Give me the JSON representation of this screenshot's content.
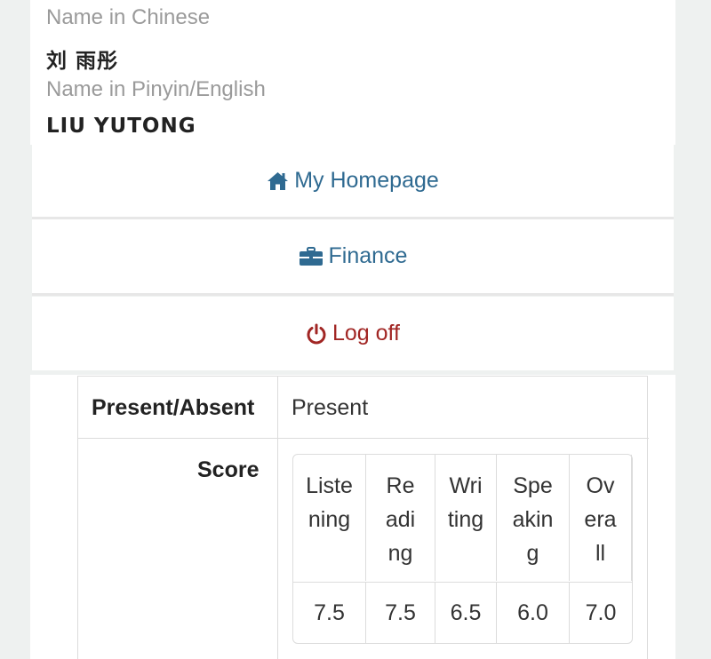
{
  "profile": {
    "name_cn_label": "Name in Chinese",
    "name_cn": "刘 雨彤",
    "name_en_label": "Name in Pinyin/English",
    "name_en": "LIU  YUTONG"
  },
  "menu": {
    "homepage": {
      "label": "My Homepage",
      "icon": "home-icon",
      "color": "#2f6a91"
    },
    "finance": {
      "label": "Finance",
      "icon": "briefcase-icon",
      "color": "#2f6a91"
    },
    "logoff": {
      "label": "Log off",
      "icon": "power-icon",
      "color": "#a12624"
    }
  },
  "record": {
    "attendance_label": "Present/Absent",
    "attendance_value": "Present",
    "score_label": "Score",
    "score_headers": [
      "Listening",
      "Reading",
      "Writing",
      "Speaking",
      "Overall"
    ],
    "score_values": [
      "7.5",
      "7.5",
      "6.5",
      "6.0",
      "7.0"
    ]
  }
}
